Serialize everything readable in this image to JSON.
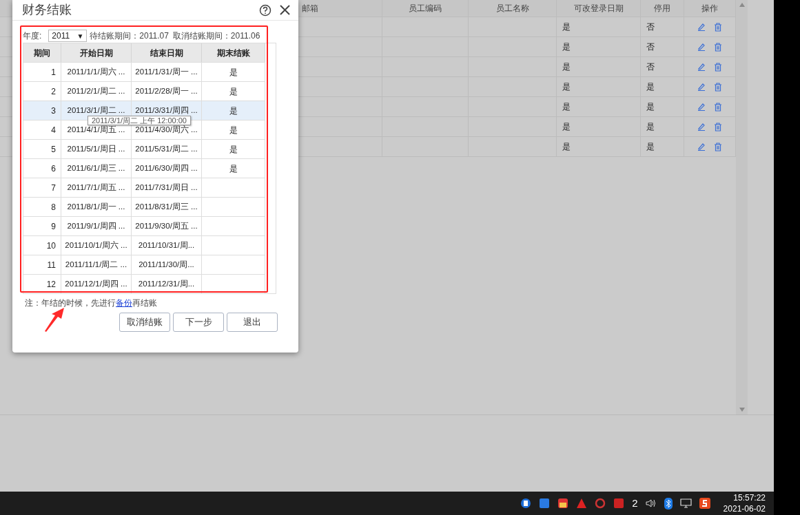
{
  "background_table": {
    "columns": [
      "邮箱",
      "员工编码",
      "员工名称",
      "可改登录日期",
      "停用",
      "操作"
    ],
    "rows": [
      {
        "login_date_editable": "是",
        "disabled": "否"
      },
      {
        "login_date_editable": "是",
        "disabled": "否"
      },
      {
        "login_date_editable": "是",
        "disabled": "否"
      },
      {
        "login_date_editable": "是",
        "disabled": "是"
      },
      {
        "login_date_editable": "是",
        "disabled": "是"
      },
      {
        "login_date_editable": "是",
        "disabled": "是"
      },
      {
        "login_date_editable": "是",
        "disabled": "是"
      }
    ]
  },
  "dialog": {
    "title": "财务结账",
    "year_label": "年度:",
    "year": "2011",
    "year_caret": "▼",
    "pending_period": "待结账期间：2011.07",
    "cancel_period": "取消结账期间：2011.06",
    "table": {
      "columns": [
        "期间",
        "开始日期",
        "结束日期",
        "期末结账"
      ],
      "rows": [
        {
          "period": "1",
          "start": "2011/1/1/周六 ...",
          "end": "2011/1/31/周一 ...",
          "closed": "是",
          "selected": false
        },
        {
          "period": "2",
          "start": "2011/2/1/周二 ...",
          "end": "2011/2/28/周一 ...",
          "closed": "是",
          "selected": false
        },
        {
          "period": "3",
          "start": "2011/3/1/周二 ...",
          "end": "2011/3/31/周四 ...",
          "closed": "是",
          "selected": true
        },
        {
          "period": "4",
          "start": "2011/4/1/周五 ...",
          "end": "2011/4/30/周六 ...",
          "closed": "是",
          "selected": false
        },
        {
          "period": "5",
          "start": "2011/5/1/周日 ...",
          "end": "2011/5/31/周二 ...",
          "closed": "是",
          "selected": false
        },
        {
          "period": "6",
          "start": "2011/6/1/周三 ...",
          "end": "2011/6/30/周四 ...",
          "closed": "是",
          "selected": false
        },
        {
          "period": "7",
          "start": "2011/7/1/周五 ...",
          "end": "2011/7/31/周日 ...",
          "selected": false
        },
        {
          "period": "8",
          "start": "2011/8/1/周一 ...",
          "end": "2011/8/31/周三 ...",
          "selected": false
        },
        {
          "period": "9",
          "start": "2011/9/1/周四 ...",
          "end": "2011/9/30/周五 ...",
          "selected": false
        },
        {
          "period": "10",
          "start": "2011/10/1/周六 ...",
          "end": "2011/10/31/周...",
          "selected": false
        },
        {
          "period": "11",
          "start": "2011/11/1/周二 ...",
          "end": "2011/11/30/周...",
          "selected": false
        },
        {
          "period": "12",
          "start": "2011/12/1/周四 ...",
          "end": "2011/12/31/周...",
          "selected": false
        }
      ]
    },
    "tooltip": "2011/3/1/周二 上午 12:00:00",
    "note": "注：年结的时候，先进行",
    "note_link": "备份",
    "note_end": "再结账",
    "buttons": [
      "取消结账",
      "下一步",
      "退出"
    ]
  },
  "taskbar": {
    "badge": "2",
    "time": "15:57:22",
    "date": "2021-06-02"
  }
}
